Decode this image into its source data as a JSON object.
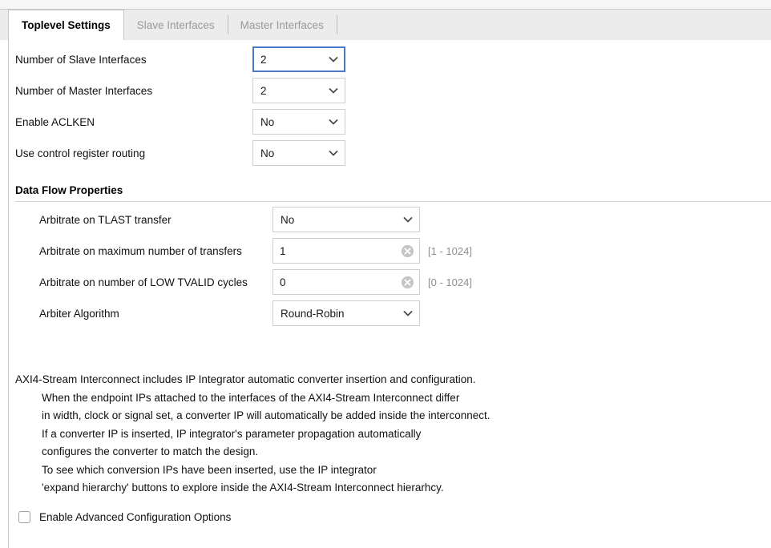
{
  "tabs": [
    {
      "label": "Toplevel Settings",
      "active": true
    },
    {
      "label": "Slave Interfaces",
      "active": false
    },
    {
      "label": "Master Interfaces",
      "active": false
    }
  ],
  "toplevel_fields": [
    {
      "label": "Number of Slave Interfaces",
      "value": "2",
      "type": "combo",
      "focused": true
    },
    {
      "label": "Number of Master Interfaces",
      "value": "2",
      "type": "combo",
      "focused": false
    },
    {
      "label": "Enable ACLKEN",
      "value": "No",
      "type": "combo",
      "focused": false
    },
    {
      "label": "Use control register routing",
      "value": "No",
      "type": "combo",
      "focused": false
    }
  ],
  "data_flow": {
    "title": "Data Flow Properties",
    "fields": [
      {
        "label": "Arbitrate on TLAST transfer",
        "value": "No",
        "type": "combo",
        "hint": ""
      },
      {
        "label": "Arbitrate on maximum number of transfers",
        "value": "1",
        "type": "text",
        "hint": "[1 - 1024]"
      },
      {
        "label": "Arbitrate on number of LOW TVALID cycles",
        "value": "0",
        "type": "text",
        "hint": "[0 - 1024]"
      },
      {
        "label": "Arbiter Algorithm",
        "value": "Round-Robin",
        "type": "combo",
        "hint": ""
      }
    ]
  },
  "description": {
    "lead": "AXI4-Stream Interconnect includes IP Integrator automatic converter insertion and configuration.",
    "lines": [
      "When the endpoint IPs attached to the interfaces of the AXI4-Stream Interconnect differ",
      "in width, clock or signal set, a converter IP will automatically be added inside the interconnect.",
      "If a converter IP is inserted, IP integrator's parameter propagation automatically",
      "configures the converter to match the design.",
      "To see which conversion IPs have been inserted, use the IP integrator",
      "'expand hierarchy' buttons to explore inside the AXI4-Stream Interconnect hierarhcy."
    ]
  },
  "advanced_checkbox": {
    "label": "Enable Advanced Configuration Options",
    "checked": false
  },
  "icons": {
    "caret": "chevron-down-icon",
    "clear": "clear-circle-x-icon"
  },
  "colors": {
    "focus_border": "#4a78c8",
    "field_border": "#cfcfcf",
    "tabbar_bg": "#ececec",
    "inactive_tab_text": "#9a9a9a",
    "hint_text": "#8e8e8e"
  }
}
